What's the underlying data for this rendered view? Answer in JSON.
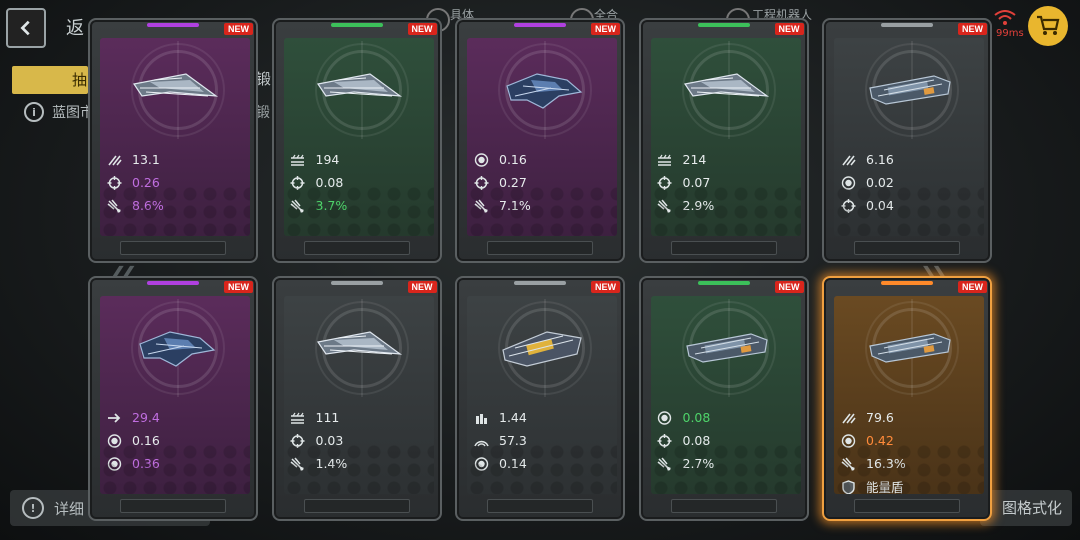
{
  "header": {
    "back_label": "返",
    "tab_active": "抽",
    "tab_fragment": "锻",
    "tab_fragment_2": "锻",
    "info_text": "蓝图市",
    "top_fragments": [
      "具体",
      "全合",
      "工程机器人"
    ],
    "ping": "99ms"
  },
  "footer": {
    "detail_label": "详细",
    "format_label": "图格式化"
  },
  "colors": {
    "purple": "#b040e0",
    "green": "#3cc05a",
    "grey": "#9aa0a3",
    "orange": "#ff8a2a",
    "new_badge": "#d9251c"
  },
  "cards": [
    {
      "rarity": "purple",
      "badge": "NEW",
      "ship_icon": "frigate-ship-icon",
      "stats": [
        {
          "icon": "dps-icon",
          "value": "13.1",
          "color": "white"
        },
        {
          "icon": "crosshair-icon",
          "value": "0.26",
          "color": "purple"
        },
        {
          "icon": "crit-icon",
          "value": "8.6%",
          "color": "purple"
        }
      ]
    },
    {
      "rarity": "green",
      "badge": "NEW",
      "ship_icon": "frigate-ship-icon",
      "stats": [
        {
          "icon": "armor-icon",
          "value": "194",
          "color": "white"
        },
        {
          "icon": "crosshair-icon",
          "value": "0.08",
          "color": "white"
        },
        {
          "icon": "crit-icon",
          "value": "3.7%",
          "color": "green"
        }
      ]
    },
    {
      "rarity": "purple",
      "badge": "NEW",
      "ship_icon": "interceptor-ship-icon",
      "stats": [
        {
          "icon": "shield-ring-icon",
          "value": "0.16",
          "color": "white"
        },
        {
          "icon": "crosshair-icon",
          "value": "0.27",
          "color": "white"
        },
        {
          "icon": "crit-icon",
          "value": "7.1%",
          "color": "white"
        }
      ]
    },
    {
      "rarity": "green",
      "badge": "NEW",
      "ship_icon": "frigate-ship-icon",
      "stats": [
        {
          "icon": "armor-icon",
          "value": "214",
          "color": "white"
        },
        {
          "icon": "crosshair-icon",
          "value": "0.07",
          "color": "white"
        },
        {
          "icon": "crit-icon",
          "value": "2.9%",
          "color": "white"
        }
      ]
    },
    {
      "rarity": "grey",
      "badge": "NEW",
      "ship_icon": "cruiser-ship-icon",
      "stats": [
        {
          "icon": "dps-icon",
          "value": "6.16",
          "color": "white"
        },
        {
          "icon": "shield-ring-icon",
          "value": "0.02",
          "color": "white"
        },
        {
          "icon": "crosshair-icon",
          "value": "0.04",
          "color": "white"
        }
      ]
    },
    {
      "rarity": "purple",
      "badge": "NEW",
      "ship_icon": "interceptor-ship-icon",
      "stats": [
        {
          "icon": "speed-icon",
          "value": "29.4",
          "color": "purple"
        },
        {
          "icon": "shield-ring-icon",
          "value": "0.16",
          "color": "white"
        },
        {
          "icon": "shield-ring-icon",
          "value": "0.36",
          "color": "purple"
        }
      ]
    },
    {
      "rarity": "grey",
      "badge": "NEW",
      "ship_icon": "frigate-ship-icon",
      "stats": [
        {
          "icon": "armor-icon",
          "value": "111",
          "color": "white"
        },
        {
          "icon": "crosshair-icon",
          "value": "0.03",
          "color": "white"
        },
        {
          "icon": "crit-icon",
          "value": "1.4%",
          "color": "white"
        }
      ]
    },
    {
      "rarity": "grey",
      "badge": "NEW",
      "ship_icon": "gunship-ship-icon",
      "stats": [
        {
          "icon": "ammo-icon",
          "value": "1.44",
          "color": "white"
        },
        {
          "icon": "range-icon",
          "value": "57.3",
          "color": "white"
        },
        {
          "icon": "shield-ring-icon",
          "value": "0.14",
          "color": "white"
        }
      ]
    },
    {
      "rarity": "green",
      "badge": "NEW",
      "ship_icon": "cruiser-ship-icon",
      "stats": [
        {
          "icon": "shield-ring-icon",
          "value": "0.08",
          "color": "green"
        },
        {
          "icon": "crosshair-icon",
          "value": "0.08",
          "color": "white"
        },
        {
          "icon": "crit-icon",
          "value": "2.7%",
          "color": "white"
        }
      ]
    },
    {
      "rarity": "orange",
      "badge": "NEW",
      "ship_icon": "cruiser-ship-icon",
      "stats": [
        {
          "icon": "dps-icon",
          "value": "79.6",
          "color": "white"
        },
        {
          "icon": "shield-ring-icon",
          "value": "0.42",
          "color": "orange"
        },
        {
          "icon": "crit-icon",
          "value": "16.3%",
          "color": "white"
        },
        {
          "icon": "energy-shield-icon",
          "value": "能量盾",
          "color": "white"
        }
      ]
    }
  ]
}
